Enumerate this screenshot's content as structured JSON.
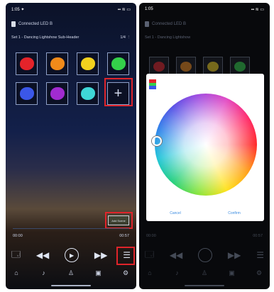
{
  "left_screen": {
    "status_time": "1:05 ✦",
    "status_icons": "▪▪ ≋ ▭",
    "app_title": "Connected LED B",
    "subbar_title": "Set 1 - Dancing Lightshow Sub-Header",
    "subbar_right": "1/4 ⋮",
    "palette_colors": [
      "#e4232a",
      "#f08a1a",
      "#f2d11e",
      "#34d04a",
      "#3b57e8",
      "#a12bd0",
      "#3fd7d7"
    ],
    "scene_button": "Add Scene",
    "time_left": "00:00",
    "time_right": "00:57",
    "controls": [
      "🗔",
      "◀◀",
      "▶",
      "▶▶",
      "☰"
    ],
    "tabs": [
      "⌂",
      "♪",
      "♙",
      "▣",
      "⚙"
    ]
  },
  "right_screen": {
    "status_time": "1:05",
    "status_icons": "▪▪ ≋ ▭",
    "app_title": "Connected LED B",
    "subbar_title": "Set 1 - Dancing Lightshow",
    "dim_colors": [
      "#e4232a",
      "#f08a1a",
      "#f2d11e",
      "#34d04a"
    ],
    "picker_swatches": [
      "#e4232a",
      "#34d04a",
      "#3b57e8"
    ],
    "picker_cancel": "Cancel",
    "picker_confirm": "Confirm",
    "time_left": "00:00",
    "time_right": "00:57",
    "controls": [
      "🗔",
      "◀◀",
      "▶",
      "▶▶",
      "☰"
    ],
    "tabs": [
      "⌂",
      "♪",
      "♙",
      "▣",
      "⚙"
    ]
  },
  "colors": {
    "highlight": "#e0242a",
    "accent": "#3a8be0"
  }
}
